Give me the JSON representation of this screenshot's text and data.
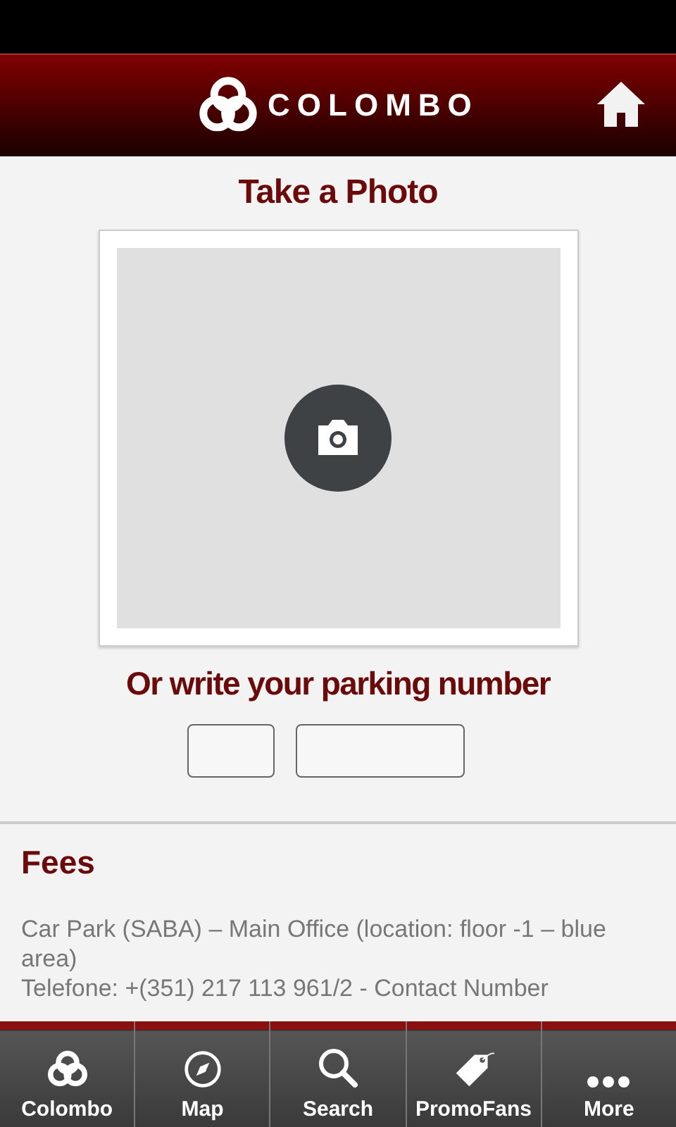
{
  "header": {
    "logo_text": "COLOMBO"
  },
  "photo": {
    "title": "Take a Photo"
  },
  "parking": {
    "heading": "Or write your parking number"
  },
  "fees": {
    "title": "Fees",
    "lines": [
      "Car Park (SABA) – Main Office (location: floor -1 – blue area)",
      "Telefone: +(351) 217 113 961/2 - Contact Number"
    ]
  },
  "tabs": [
    {
      "label": "Colombo",
      "kind": "knot"
    },
    {
      "label": "Map",
      "kind": "compass"
    },
    {
      "label": "Search",
      "kind": "search"
    },
    {
      "label": "PromoFans",
      "kind": "tag"
    },
    {
      "label": "More",
      "kind": "more"
    }
  ]
}
